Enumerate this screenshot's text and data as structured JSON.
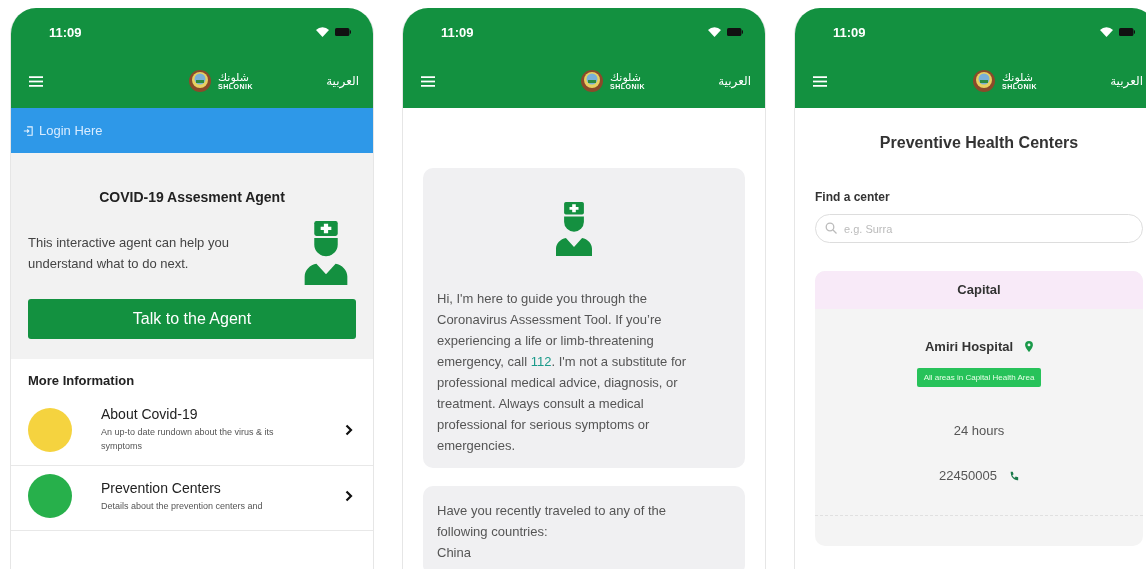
{
  "phones": [
    {
      "kind": "home",
      "status": {
        "time": "11:09"
      },
      "nav": {
        "logo_arabic": "شلونك",
        "logo_latin": "SHLONIK",
        "language": "العربية"
      },
      "login": {
        "label": "Login Here"
      },
      "agent_card": {
        "title": "COVID-19 Assesment Agent",
        "text": "This interactive agent can help you understand what to do next.",
        "button": "Talk to the Agent"
      },
      "more_info": {
        "heading": "More Information",
        "items": [
          {
            "title": "About Covid-19",
            "description": "An up-to date rundown about the virus & its symptoms",
            "color": "#f5d33f"
          },
          {
            "title": "Prevention Centers",
            "description": "Details about the prevention centers and",
            "color": "#27b04b"
          }
        ]
      }
    },
    {
      "kind": "chat",
      "status": {
        "time": "11:09"
      },
      "nav": {
        "logo_arabic": "شلونك",
        "logo_latin": "SHLONIK",
        "language": "العربية"
      },
      "messages": [
        {
          "before": "Hi, I'm here to guide you through the Coronavirus Assessment Tool. If you’re experiencing a life or limb-threatening emergency, call ",
          "link": "112",
          "after": ". I'm not a substitute for professional medical advice, diagnosis, or treatment. Always consult a medical professional for serious symptoms or emergencies.",
          "kind": "intro"
        },
        {
          "before": "Have you recently traveled to any of the following countries:",
          "kind": "question",
          "lines": [
            "China"
          ]
        }
      ]
    },
    {
      "kind": "centers",
      "status": {
        "time": "11:09"
      },
      "nav": {
        "logo_arabic": "شلونك",
        "logo_latin": "SHLONIK",
        "language": "العربية"
      },
      "title": "Preventive Health Centers",
      "search": {
        "label": "Find a center",
        "placeholder": "e.g. Surra"
      },
      "region": {
        "name": "Capital",
        "center": {
          "name": "Amiri Hospital",
          "area": "All areas in Capital Health Area",
          "hours": "24 hours",
          "phone": "22450005"
        }
      }
    }
  ]
}
